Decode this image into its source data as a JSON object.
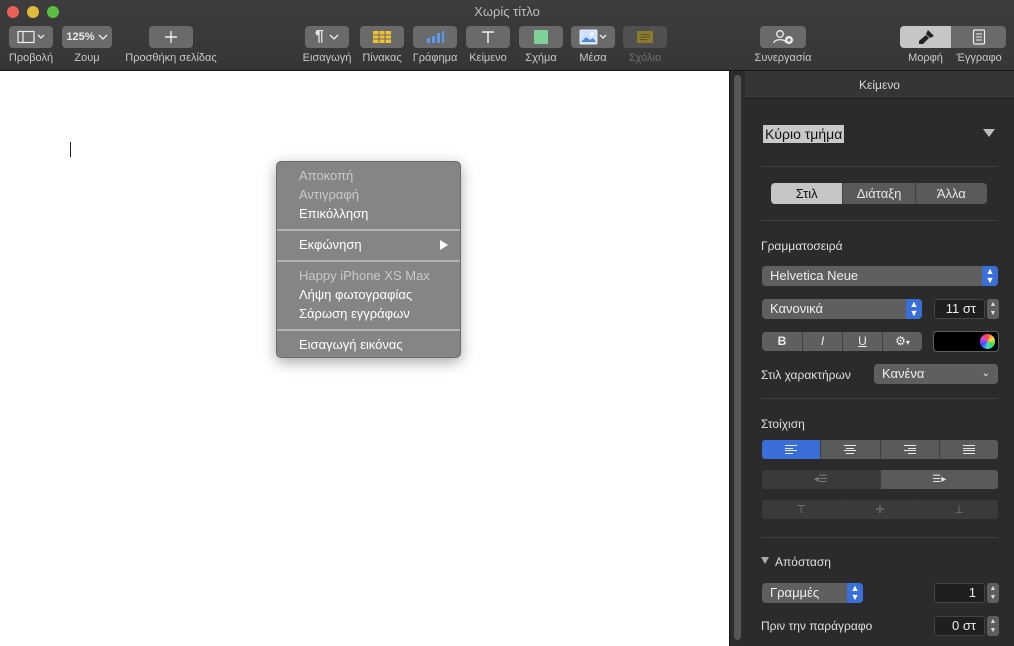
{
  "window": {
    "title": "Χωρίς τίτλο"
  },
  "toolbar": {
    "view_label": "Προβολή",
    "zoom_value": "125%",
    "zoom_label": "Ζουμ",
    "add_page_label": "Προσθήκη σελίδας",
    "insert_label": "Εισαγωγή",
    "table_label": "Πίνακας",
    "chart_label": "Γράφημα",
    "text_label": "Κείμενο",
    "shape_label": "Σχήμα",
    "media_label": "Μέσα",
    "comment_label": "Σχόλιο",
    "collaborate_label": "Συνεργασία",
    "format_label": "Μορφή",
    "document_label": "Έγγραφο"
  },
  "context_menu": {
    "cut": "Αποκοπή",
    "copy": "Αντιγραφή",
    "paste": "Επικόλληση",
    "speech": "Εκφώνηση",
    "device": "Happy iPhone XS Max",
    "take_photo": "Λήψη φωτογραφίας",
    "scan_documents": "Σάρωση εγγράφων",
    "insert_image": "Εισαγωγή εικόνας"
  },
  "sidebar": {
    "header": "Κείμενο",
    "paragraph_style": "Κύριο τμήμα",
    "tabs": [
      "Στιλ",
      "Διάταξη",
      "Άλλα"
    ],
    "font_section": "Γραμματοσειρά",
    "font_family": "Helvetica Neue",
    "font_typeface": "Κανονικά",
    "font_size": "11 στ",
    "bold": "B",
    "italic": "I",
    "underline": "U",
    "text_color": "#000000",
    "char_style_label": "Στιλ χαρακτήρων",
    "char_style_value": "Κανένα",
    "alignment_section": "Στοίχιση",
    "spacing_section": "Απόσταση",
    "spacing_mode": "Γραμμές",
    "spacing_value": "1",
    "before_paragraph_label": "Πριν την παράγραφο",
    "before_paragraph_value": "0 στ"
  },
  "colors": {
    "accent": "#3b6fd8",
    "toolbar": "#3a3a3a",
    "sidebar": "#2b2b2b",
    "menu": "#808080"
  }
}
